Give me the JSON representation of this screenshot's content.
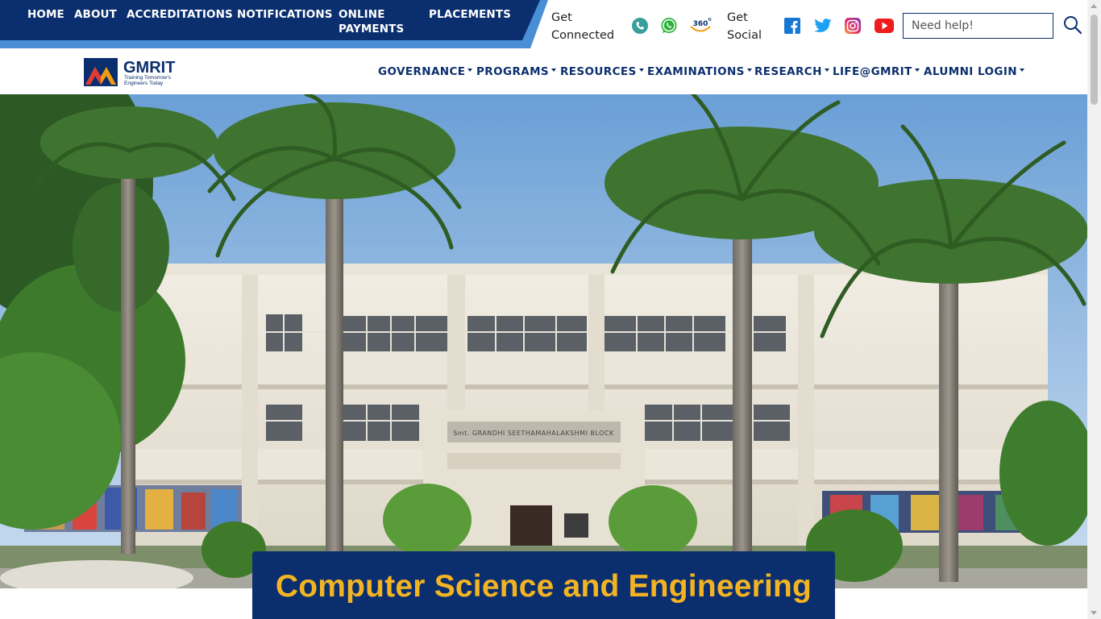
{
  "topbar": {
    "nav_items": [
      {
        "label": "HOME"
      },
      {
        "label": "ABOUT"
      },
      {
        "label": "ACCREDITATIONS"
      },
      {
        "label": "NOTIFICATIONS"
      },
      {
        "label": "ONLINE PAYMENTS",
        "line1": "ONLINE",
        "line2": "PAYMENTS"
      },
      {
        "label": "PLACEMENTS"
      }
    ],
    "get_connected": {
      "line1": "Get",
      "line2": "Connected"
    },
    "get_social": {
      "line1": "Get",
      "line2": "Social"
    },
    "connect_icons": [
      "phone-icon",
      "whatsapp-icon",
      "virtual-tour-360-icon"
    ],
    "virtual_tour_label": "360",
    "social_icons": [
      "facebook-icon",
      "twitter-icon",
      "instagram-icon",
      "youtube-icon"
    ],
    "help_placeholder": "Need help!",
    "colors": {
      "nav_blue": "#0b2f6e",
      "nav_stripe": "#4a8fd6"
    }
  },
  "header": {
    "logo_name": "GMRIT",
    "logo_tagline_1": "Training Tomorrow's",
    "logo_tagline_2": "Engineers Today",
    "menu": [
      {
        "label": "GOVERNANCE",
        "dropdown": true
      },
      {
        "label": "PROGRAMS",
        "dropdown": true
      },
      {
        "label": "RESOURCES",
        "dropdown": true
      },
      {
        "label": "EXAMINATIONS",
        "dropdown": true
      },
      {
        "label": "RESEARCH",
        "dropdown": true
      },
      {
        "label": "LIFE@GMRIT",
        "dropdown": true
      },
      {
        "label": "ALUMNI",
        "dropdown": false
      },
      {
        "label": "LOGIN",
        "dropdown": true
      }
    ]
  },
  "hero": {
    "building_sign": "Smt. GRANDHI SEETHAMAHALAKSHMI BLOCK",
    "banner_title": "Computer Science and Engineering",
    "colors": {
      "banner_bg": "#0b2f6e",
      "banner_text": "#f3b423"
    }
  }
}
